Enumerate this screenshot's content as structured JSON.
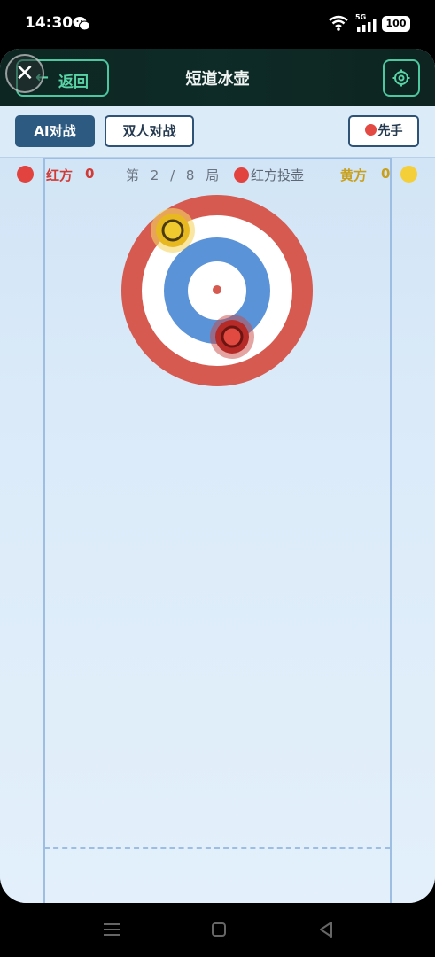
{
  "status_bar": {
    "time": "14:30",
    "network": "5G",
    "battery": "100"
  },
  "header": {
    "back_arrow": "←",
    "back_label": "返回",
    "title": "短道冰壶",
    "close_glyph": "✕"
  },
  "modes": {
    "ai": "AI对战",
    "pvp": "双人对战",
    "first_move": "先手"
  },
  "scoreboard": {
    "red_label": "红方",
    "red_score": "0",
    "round": "第 2 / 8 局",
    "turn": "红方投壶",
    "yellow_label": "黄方",
    "yellow_score": "0"
  },
  "colors": {
    "red_team": "#e2433e",
    "yellow_team": "#f5cf3a",
    "accent": "#4dc79f",
    "house_outer": "#d65a4f",
    "house_inner": "#5b93d8"
  },
  "stones": [
    {
      "team": "yellow",
      "icon": "yellow-stone-icon"
    },
    {
      "team": "red",
      "icon": "red-stone-icon"
    }
  ]
}
